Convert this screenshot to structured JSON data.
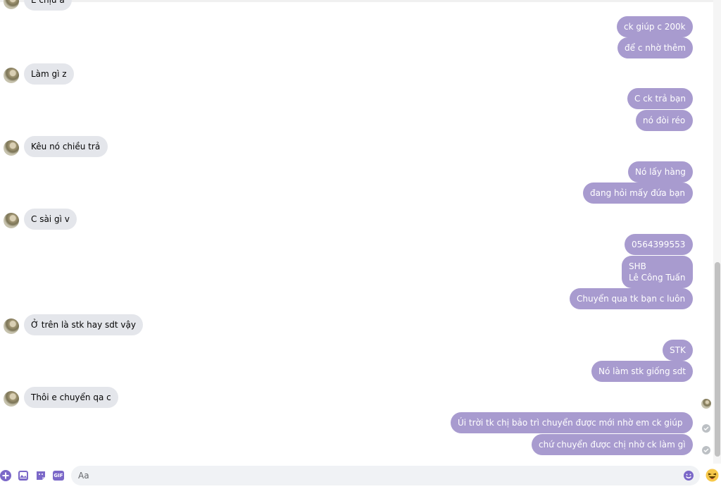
{
  "messages": [
    {
      "side": "in",
      "text": "E chịu á",
      "avatar": true
    },
    {
      "side": "out",
      "text": "ck giúp c 200k"
    },
    {
      "side": "out",
      "text": "để c nhờ thêm"
    },
    {
      "side": "in",
      "text": "Làm gì z",
      "avatar": true
    },
    {
      "side": "out",
      "text": "C ck trả bạn"
    },
    {
      "side": "out",
      "text": "nó đòi réo"
    },
    {
      "side": "in",
      "text": "Kêu nó chiều trả",
      "avatar": true
    },
    {
      "side": "out",
      "text": "Nó lấy hàng"
    },
    {
      "side": "out",
      "text": "đang hỏi mấy đứa bạn"
    },
    {
      "side": "in",
      "text": "C sài gì v",
      "avatar": true
    },
    {
      "side": "out",
      "text": "0564399553"
    },
    {
      "side": "out",
      "lines": [
        "SHB",
        "Lê Công Tuấn"
      ]
    },
    {
      "side": "out",
      "text": "Chuyển qua tk bạn c luôn"
    },
    {
      "side": "in",
      "text": "Ở trên là stk hay sdt vậy",
      "avatar": true
    },
    {
      "side": "out",
      "text": "STK"
    },
    {
      "side": "out",
      "text": "Nó làm stk giống sdt"
    },
    {
      "side": "in",
      "text": "Thôi e chuyển qa c",
      "avatar": true
    },
    {
      "side": "out",
      "text": "Úi trời tk chị bảo trì  chuyển được mới nhờ em ck giúp",
      "status": "sent"
    },
    {
      "side": "out",
      "text": "chứ chuyển được chị nhờ ck làm gì",
      "status": "sent"
    }
  ],
  "composer": {
    "placeholder": "Aa",
    "tools": [
      "plus-circle-icon",
      "image-icon",
      "sticker-icon",
      "gif-icon"
    ],
    "gif_label": "GIF",
    "right_icons": [
      "emoji-icon",
      "haha-reaction-icon"
    ]
  },
  "colors": {
    "outgoing": "#a89bcf",
    "incoming": "#e4e6eb",
    "accent": "#7b68c8"
  }
}
